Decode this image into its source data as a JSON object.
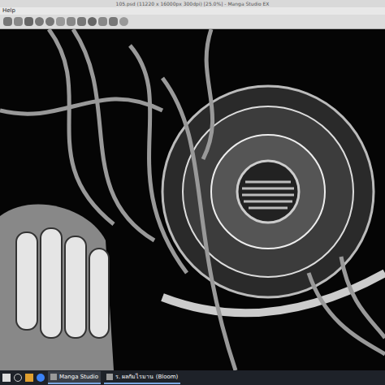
{
  "window": {
    "title": "105.psd (11220 x 16000px 300dpi) [25.0%] - Manga Studio EX"
  },
  "menu": [
    {
      "label": "Help"
    }
  ],
  "taskbar": {
    "items": [
      {
        "label": "Manga Studio",
        "selected": true
      },
      {
        "label": "ร. ผลกัมไรมาน (Bloom)",
        "selected": false
      }
    ]
  }
}
